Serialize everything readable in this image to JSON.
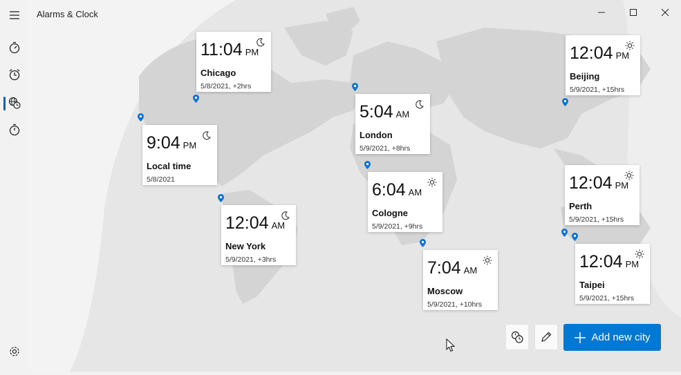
{
  "app": {
    "title": "Alarms & Clock"
  },
  "window_controls": {
    "minimize": "minimize-icon",
    "maximize": "maximize-icon",
    "close": "close-icon"
  },
  "sidebar": {
    "items": [
      {
        "name": "menu",
        "icon": "hamburger-icon"
      },
      {
        "name": "focus-sessions",
        "icon": "stopwatch-icon"
      },
      {
        "name": "alarm",
        "icon": "alarm-clock-icon"
      },
      {
        "name": "world-clock",
        "icon": "world-clock-icon",
        "active": true
      },
      {
        "name": "stopwatch",
        "icon": "stopwatch-icon"
      },
      {
        "name": "settings",
        "icon": "gear-icon"
      }
    ]
  },
  "cities": [
    {
      "time": "11:04",
      "ampm": "PM",
      "city": "Chicago",
      "info": "5/8/2021, +2hrs",
      "weather": "moon"
    },
    {
      "time": "5:04",
      "ampm": "AM",
      "city": "London",
      "info": "5/9/2021, +8hrs",
      "weather": "moon"
    },
    {
      "time": "12:04",
      "ampm": "PM",
      "city": "Beijing",
      "info": "5/9/2021, +15hrs",
      "weather": "sun"
    },
    {
      "time": "9:04",
      "ampm": "PM",
      "city": "Local time",
      "info": "5/8/2021",
      "weather": "moon"
    },
    {
      "time": "6:04",
      "ampm": "AM",
      "city": "Cologne",
      "info": "5/9/2021, +9hrs",
      "weather": "sun"
    },
    {
      "time": "12:04",
      "ampm": "PM",
      "city": "Perth",
      "info": "5/9/2021, +15hrs",
      "weather": "sun"
    },
    {
      "time": "12:04",
      "ampm": "AM",
      "city": "New York",
      "info": "5/9/2021, +3hrs",
      "weather": "moon"
    },
    {
      "time": "7:04",
      "ampm": "AM",
      "city": "Moscow",
      "info": "5/9/2021, +10hrs",
      "weather": "sun"
    },
    {
      "time": "12:04",
      "ampm": "PM",
      "city": "Taipei",
      "info": "5/9/2021, +15hrs",
      "weather": "sun"
    }
  ],
  "toolbar": {
    "compare_icon": "compare-time-icon",
    "edit_icon": "pencil-icon",
    "add_label": "Add new city"
  },
  "colors": {
    "accent": "#0078d4",
    "pin": "#0a74d6"
  }
}
